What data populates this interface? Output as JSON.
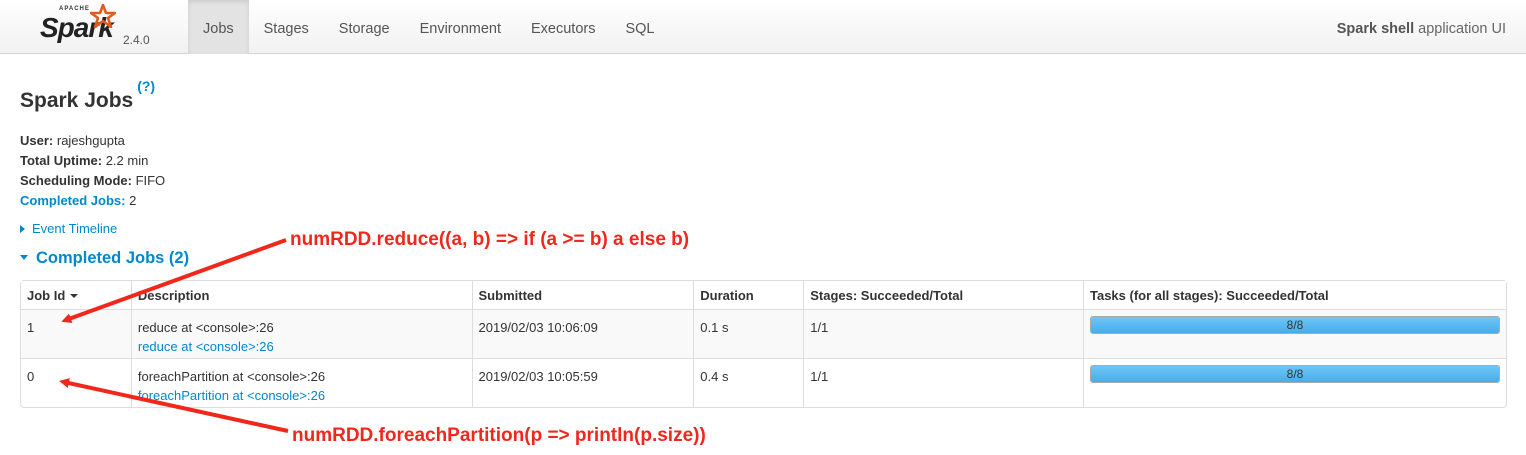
{
  "brand": {
    "apache": "APACHE",
    "name": "Spark",
    "version": "2.4.0"
  },
  "nav": {
    "tabs": [
      "Jobs",
      "Stages",
      "Storage",
      "Environment",
      "Executors",
      "SQL"
    ],
    "active": "Jobs",
    "app_title_bold": "Spark shell",
    "app_title_rest": " application UI"
  },
  "page": {
    "title": "Spark Jobs",
    "help": "(?)",
    "summary": {
      "user_label": "User:",
      "user": " rajeshgupta",
      "uptime_label": "Total Uptime:",
      "uptime": " 2.2 min",
      "mode_label": "Scheduling Mode:",
      "mode": " FIFO",
      "completed_label": "Completed Jobs:",
      "completed": " 2"
    },
    "event_timeline": "Event Timeline",
    "completed_header": "Completed Jobs (2)"
  },
  "table": {
    "headers": [
      "Job Id",
      "Description",
      "Submitted",
      "Duration",
      "Stages: Succeeded/Total",
      "Tasks (for all stages): Succeeded/Total"
    ],
    "rows": [
      {
        "job_id": "1",
        "desc": "reduce at <console>:26",
        "desc_link": "reduce at <console>:26",
        "submitted": "2019/02/03 10:06:09",
        "duration": "0.1 s",
        "stages": "1/1",
        "tasks": "8/8",
        "progress": 1.0
      },
      {
        "job_id": "0",
        "desc": "foreachPartition at <console>:26",
        "desc_link": "foreachPartition at <console>:26",
        "submitted": "2019/02/03 10:05:59",
        "duration": "0.4 s",
        "stages": "1/1",
        "tasks": "8/8",
        "progress": 1.0
      }
    ]
  },
  "annotations": {
    "top": "numRDD.reduce((a, b) => if (a >= b) a else b)",
    "bottom": "numRDD.foreachPartition(p => println(p.size))",
    "color": "#f0281c"
  },
  "colors": {
    "link": "#0088cc",
    "progress": "#47adea"
  }
}
